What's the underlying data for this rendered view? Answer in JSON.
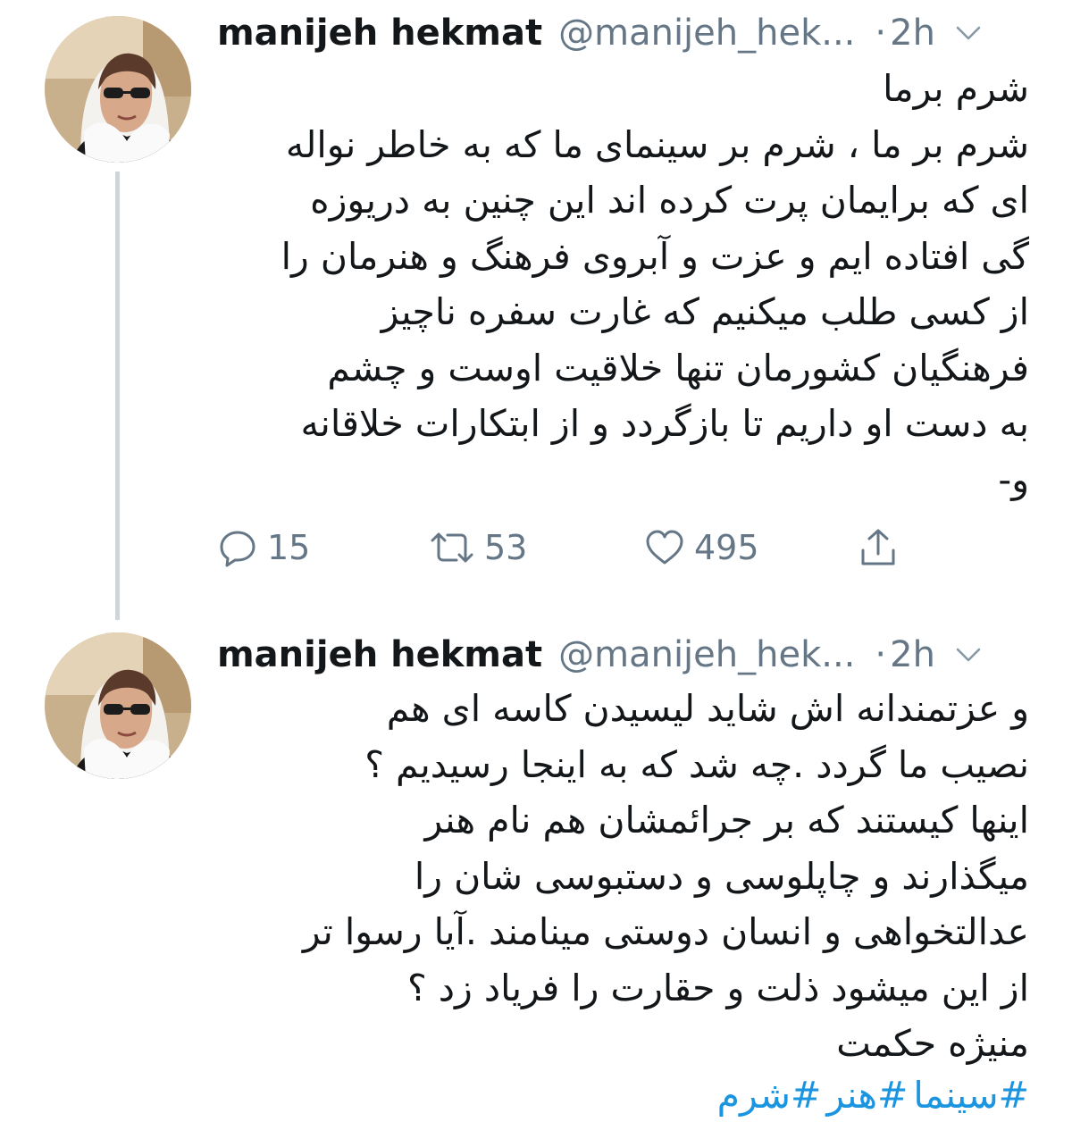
{
  "tweets": [
    {
      "author": {
        "display_name": "manijeh hekmat",
        "handle": "@manijeh_hek...",
        "avatar_icon": "user-avatar"
      },
      "separator": "·",
      "time": "2h",
      "menu_icon": "chevron-down-icon",
      "body_lines": [
        "شرم برما",
        "شرم بر ما ، شرم بر سینمای ما که به خاطر نواله",
        "ای که برایمان پرت کرده اند این چنین به دریوزه",
        "گی افتاده ایم و عزت و آبروی فرهنگ و هنرمان را",
        "از کسی طلب میکنیم که  غارت سفره ناچیز",
        "فرهنگیان کشورمان تنها خلاقیت اوست  و چشم",
        "به دست او داریم تا بازگردد و از ابتکارات خلاقانه",
        "و-"
      ],
      "actions": {
        "reply_count": "15",
        "retweet_count": "53",
        "like_count": "495"
      }
    },
    {
      "author": {
        "display_name": "manijeh hekmat",
        "handle": "@manijeh_hek...",
        "avatar_icon": "user-avatar"
      },
      "separator": "·",
      "time": "2h",
      "menu_icon": "chevron-down-icon",
      "body_lines": [
        "و عزتمندانه اش  شاید لیسیدن کاسه ای هم",
        "نصیب ما گردد .چه شد که به اینجا رسیدیم ؟",
        "اینها کیستند که بر جرائمشان هم نام هنر",
        "میگذارند و چاپلوسی و دستبوسی شان را",
        "عدالتخواهی و انسان دوستی مینامند .آیا رسوا تر",
        "از این میشود ذلت و حقارت را فریاد زد ؟",
        "منیژه حکمت"
      ],
      "hashtags": [
        "#سینما",
        "#هنر",
        "#شرم"
      ]
    }
  ],
  "colors": {
    "text": "#14171a",
    "secondary": "#657786",
    "link": "#1b95e0",
    "thread_line": "#ccd6dd"
  }
}
